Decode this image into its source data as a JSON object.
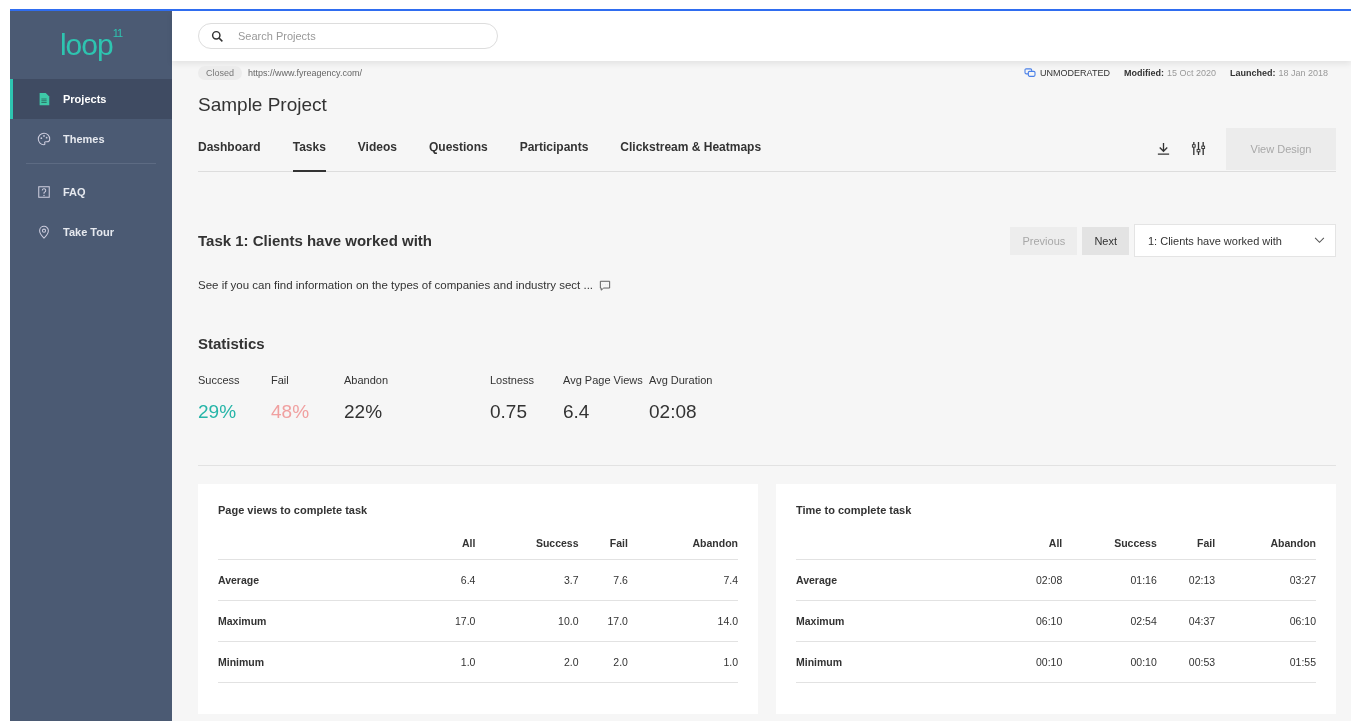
{
  "logo": {
    "text": "loop",
    "sup": "11"
  },
  "sidebar": {
    "items": [
      {
        "label": "Projects",
        "selected": true
      },
      {
        "label": "Themes",
        "selected": false
      },
      {
        "label": "FAQ",
        "selected": false
      },
      {
        "label": "Take Tour",
        "selected": false
      }
    ]
  },
  "search": {
    "placeholder": "Search Projects"
  },
  "project": {
    "status": "Closed",
    "url": "https://www.fyreagency.com/",
    "type": "UNMODERATED",
    "modified_label": "Modified:",
    "modified": "15 Oct 2020",
    "launched_label": "Launched:",
    "launched": "18 Jan 2018",
    "title": "Sample Project"
  },
  "tabs": [
    {
      "label": "Dashboard",
      "selected": false
    },
    {
      "label": "Tasks",
      "selected": true
    },
    {
      "label": "Videos",
      "selected": false
    },
    {
      "label": "Questions",
      "selected": false
    },
    {
      "label": "Participants",
      "selected": false
    },
    {
      "label": "Clickstream & Heatmaps",
      "selected": false
    }
  ],
  "view_design": {
    "label": "View Design",
    "disabled": true
  },
  "task": {
    "title": "Task 1: Clients have worked with",
    "description": "See if you can find information on the types of companies and industry sect ...",
    "previous": {
      "label": "Previous",
      "disabled": true
    },
    "next": {
      "label": "Next",
      "disabled": false
    },
    "select": "1: Clients have worked with"
  },
  "statistics": {
    "title": "Statistics",
    "items": [
      {
        "label": "Success",
        "value": "29%",
        "color": "#26b5a8"
      },
      {
        "label": "Fail",
        "value": "48%",
        "color": "#f0a0a0"
      },
      {
        "label": "Abandon",
        "value": "22%",
        "color": "#333333"
      },
      {
        "label": "Lostness",
        "value": "0.75",
        "color": "#333333"
      },
      {
        "label": "Avg Page Views",
        "value": "6.4",
        "color": "#333333"
      },
      {
        "label": "Avg Duration",
        "value": "02:08",
        "color": "#333333"
      }
    ]
  },
  "tables": [
    {
      "title": "Page views to complete task",
      "columns": [
        "All",
        "Success",
        "Fail",
        "Abandon"
      ],
      "rows": [
        {
          "label": "Average",
          "cells": [
            "6.4",
            "3.7",
            "7.6",
            "7.4"
          ]
        },
        {
          "label": "Maximum",
          "cells": [
            "17.0",
            "10.0",
            "17.0",
            "14.0"
          ]
        },
        {
          "label": "Minimum",
          "cells": [
            "1.0",
            "2.0",
            "2.0",
            "1.0"
          ]
        }
      ]
    },
    {
      "title": "Time to complete task",
      "columns": [
        "All",
        "Success",
        "Fail",
        "Abandon"
      ],
      "rows": [
        {
          "label": "Average",
          "cells": [
            "02:08",
            "01:16",
            "02:13",
            "03:27"
          ]
        },
        {
          "label": "Maximum",
          "cells": [
            "06:10",
            "02:54",
            "04:37",
            "06:10"
          ]
        },
        {
          "label": "Minimum",
          "cells": [
            "00:10",
            "00:10",
            "00:53",
            "01:55"
          ]
        }
      ]
    }
  ]
}
